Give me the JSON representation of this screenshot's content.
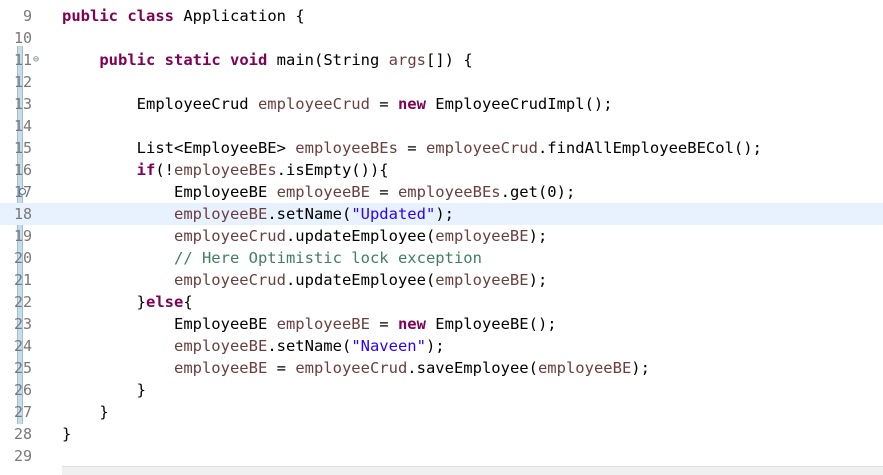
{
  "editor": {
    "current_line": 18,
    "lines": [
      {
        "n": "9",
        "tokens": [
          [
            "kw",
            "public"
          ],
          [
            "t",
            " "
          ],
          [
            "kw",
            "class"
          ],
          [
            "t",
            " Application {"
          ]
        ]
      },
      {
        "n": "10",
        "tokens": []
      },
      {
        "n": "11",
        "marker": "fold-collapse",
        "tokens": [
          [
            "t",
            "    "
          ],
          [
            "kw",
            "public"
          ],
          [
            "t",
            " "
          ],
          [
            "kw",
            "static"
          ],
          [
            "t",
            " "
          ],
          [
            "kw",
            "void"
          ],
          [
            "t",
            " main(String "
          ],
          [
            "var",
            "args"
          ],
          [
            "t",
            "[]) {"
          ]
        ]
      },
      {
        "n": "12",
        "tokens": []
      },
      {
        "n": "13",
        "tokens": [
          [
            "t",
            "        EmployeeCrud "
          ],
          [
            "var",
            "employeeCrud"
          ],
          [
            "t",
            " = "
          ],
          [
            "kw",
            "new"
          ],
          [
            "t",
            " EmployeeCrudImpl();"
          ]
        ]
      },
      {
        "n": "14",
        "tokens": []
      },
      {
        "n": "15",
        "tokens": [
          [
            "t",
            "        List<EmployeeBE> "
          ],
          [
            "var",
            "employeeBEs"
          ],
          [
            "t",
            " = "
          ],
          [
            "var",
            "employeeCrud"
          ],
          [
            "t",
            ".findAllEmployeeBECol();"
          ]
        ]
      },
      {
        "n": "16",
        "tokens": [
          [
            "t",
            "        "
          ],
          [
            "kw",
            "if"
          ],
          [
            "t",
            "(!"
          ],
          [
            "var",
            "employeeBEs"
          ],
          [
            "t",
            ".isEmpty()){"
          ]
        ]
      },
      {
        "n": "17",
        "marker": "breakpoint",
        "tokens": [
          [
            "t",
            "            EmployeeBE "
          ],
          [
            "var",
            "employeeBE"
          ],
          [
            "t",
            " = "
          ],
          [
            "var",
            "employeeBEs"
          ],
          [
            "t",
            ".get(0);"
          ]
        ]
      },
      {
        "n": "18",
        "tokens": [
          [
            "t",
            "            "
          ],
          [
            "var",
            "employeeBE"
          ],
          [
            "t",
            ".setName("
          ],
          [
            "str",
            "\"Updated\""
          ],
          [
            "t",
            ");"
          ]
        ]
      },
      {
        "n": "19",
        "tokens": [
          [
            "t",
            "            "
          ],
          [
            "var",
            "employeeCrud"
          ],
          [
            "t",
            ".updateEmployee("
          ],
          [
            "var",
            "employeeBE"
          ],
          [
            "t",
            ");"
          ]
        ]
      },
      {
        "n": "20",
        "tokens": [
          [
            "t",
            "            "
          ],
          [
            "cm",
            "// Here Optimistic lock exception"
          ]
        ]
      },
      {
        "n": "21",
        "tokens": [
          [
            "t",
            "            "
          ],
          [
            "var",
            "employeeCrud"
          ],
          [
            "t",
            ".updateEmployee("
          ],
          [
            "var",
            "employeeBE"
          ],
          [
            "t",
            ");"
          ]
        ]
      },
      {
        "n": "22",
        "tokens": [
          [
            "t",
            "        }"
          ],
          [
            "kw",
            "else"
          ],
          [
            "t",
            "{"
          ]
        ]
      },
      {
        "n": "23",
        "tokens": [
          [
            "t",
            "            EmployeeBE "
          ],
          [
            "var",
            "employeeBE"
          ],
          [
            "t",
            " = "
          ],
          [
            "kw",
            "new"
          ],
          [
            "t",
            " EmployeeBE();"
          ]
        ]
      },
      {
        "n": "24",
        "tokens": [
          [
            "t",
            "            "
          ],
          [
            "var",
            "employeeBE"
          ],
          [
            "t",
            ".setName("
          ],
          [
            "str",
            "\"Naveen\""
          ],
          [
            "t",
            ");"
          ]
        ]
      },
      {
        "n": "25",
        "tokens": [
          [
            "t",
            "            "
          ],
          [
            "var",
            "employeeBE"
          ],
          [
            "t",
            " = "
          ],
          [
            "var",
            "employeeCrud"
          ],
          [
            "t",
            ".saveEmployee("
          ],
          [
            "var",
            "employeeBE"
          ],
          [
            "t",
            ");"
          ]
        ]
      },
      {
        "n": "26",
        "tokens": [
          [
            "t",
            "        }"
          ]
        ]
      },
      {
        "n": "27",
        "tokens": [
          [
            "t",
            "    }"
          ]
        ]
      },
      {
        "n": "28",
        "tokens": [
          [
            "t",
            "}"
          ]
        ]
      },
      {
        "n": "29",
        "tokens": []
      }
    ]
  }
}
